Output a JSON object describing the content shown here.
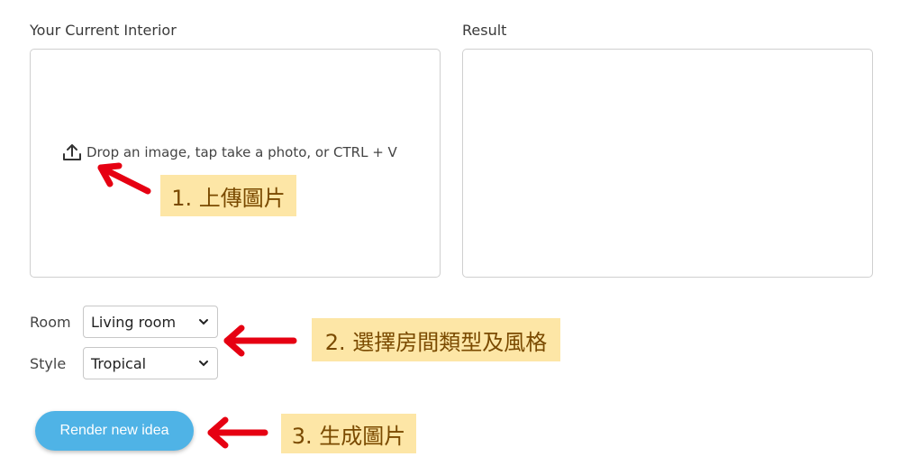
{
  "panels": {
    "left_title": "Your Current Interior",
    "right_title": "Result"
  },
  "upload": {
    "text": "Drop an image, tap take a photo, or CTRL + V"
  },
  "form": {
    "room_label": "Room",
    "room_value": "Living room",
    "style_label": "Style",
    "style_value": "Tropical"
  },
  "actions": {
    "render_label": "Render new idea"
  },
  "annotations": {
    "step1": "1. 上傳圖片",
    "step2": "2. 選擇房間類型及風格",
    "step3": "3. 生成圖片"
  },
  "colors": {
    "button_bg": "#4fb3e6",
    "note_bg": "#fde6a6",
    "arrow": "#e60012"
  }
}
